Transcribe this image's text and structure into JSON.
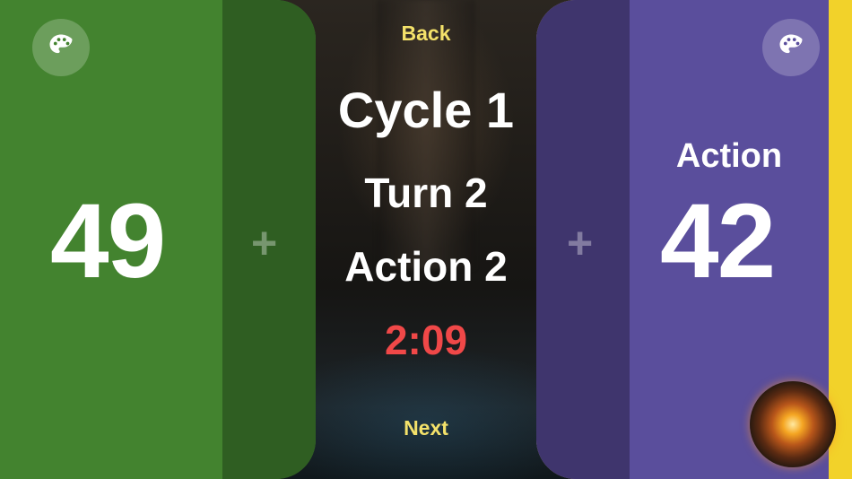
{
  "center": {
    "back_label": "Back",
    "cycle_label": "Cycle 1",
    "turn_label": "Turn 2",
    "action_label": "Action 2",
    "timer": "2:09",
    "next_label": "Next"
  },
  "player_left": {
    "life": "49",
    "plus_symbol": "+",
    "color": "#43832f",
    "icon": "palette-icon"
  },
  "player_right": {
    "life": "42",
    "plus_symbol": "+",
    "status_label": "Action",
    "color": "#5a4e9c",
    "active_indicator_color": "#f2d22a",
    "icon": "palette-icon"
  },
  "colors": {
    "timer": "#f04848",
    "nav_text": "#f4e26a"
  }
}
